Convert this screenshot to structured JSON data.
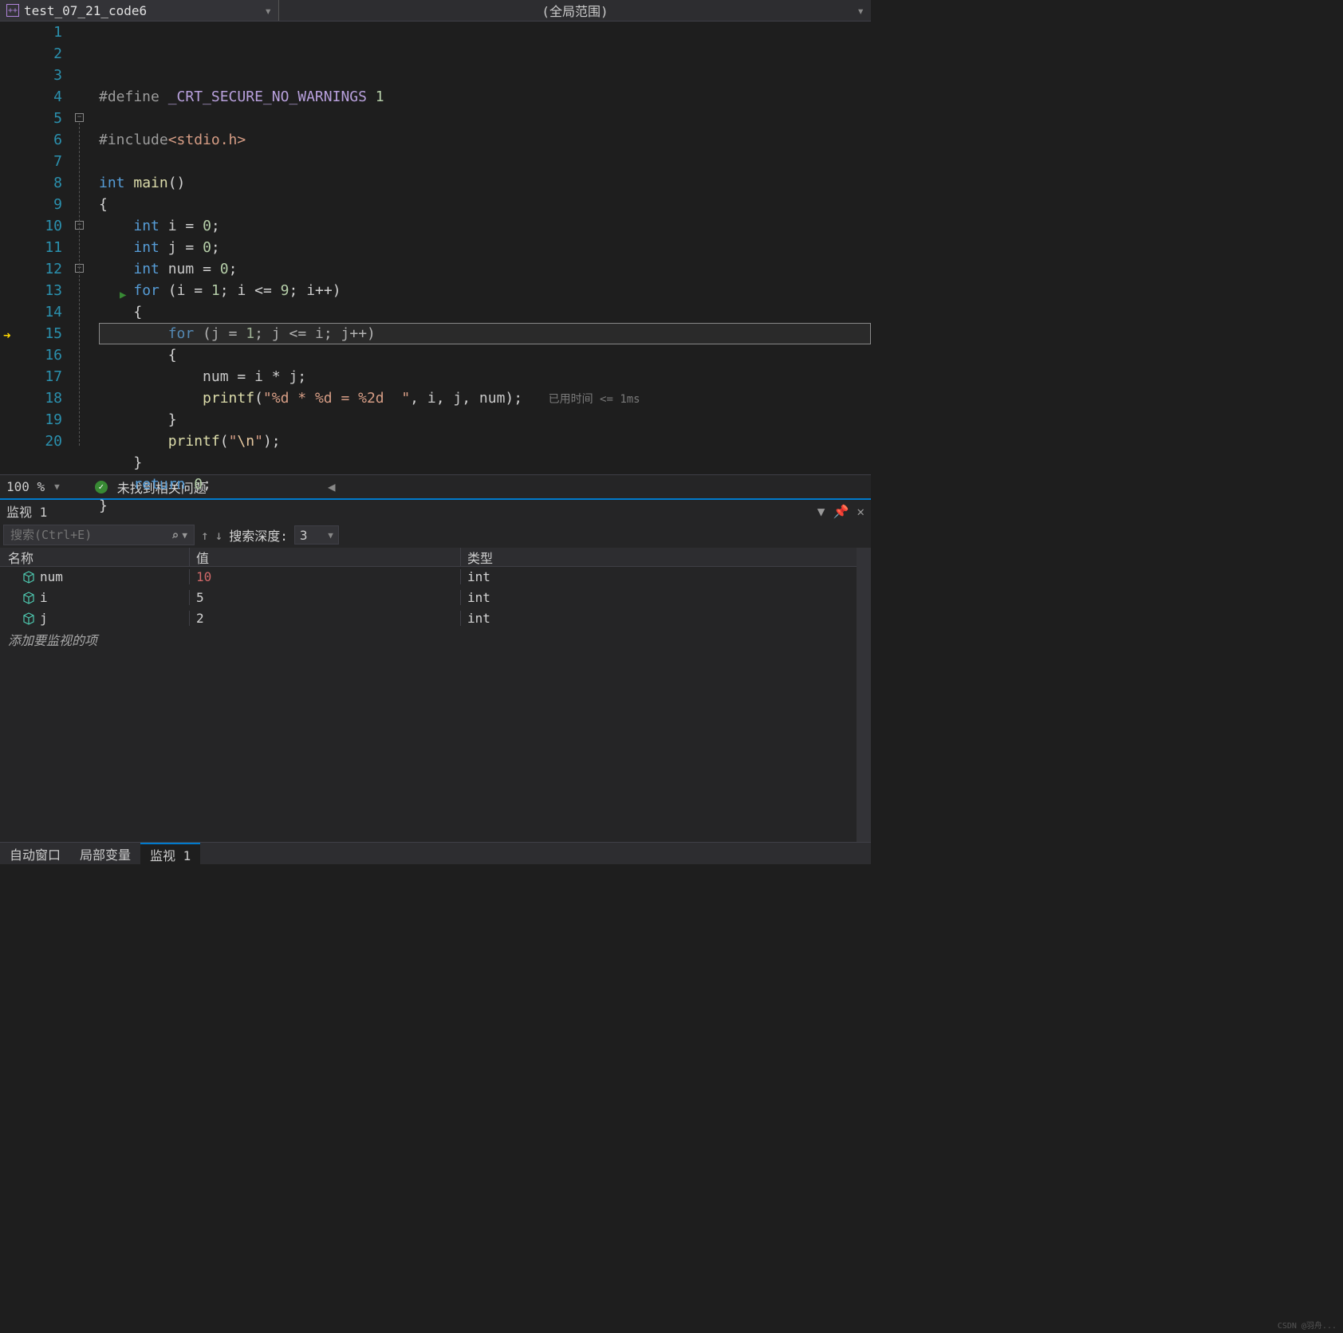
{
  "header": {
    "file_name": "test_07_21_code6",
    "scope": "(全局范围)"
  },
  "editor": {
    "current_line_index": 14,
    "lines": [
      {
        "n": 1,
        "html": "<span class='pp'>#define </span><span class='mac'>_CRT_SECURE_NO_WARNINGS</span> <span class='num'>1</span>"
      },
      {
        "n": 2,
        "html": ""
      },
      {
        "n": 3,
        "html": "<span class='pp'>#include</span><span class='angle'>&lt;stdio.h&gt;</span>"
      },
      {
        "n": 4,
        "html": ""
      },
      {
        "n": 5,
        "html": "<span class='kw'>int</span> <span class='fn'>main</span><span class='punc'>()</span>"
      },
      {
        "n": 6,
        "html": "<span class='punc'>{</span>"
      },
      {
        "n": 7,
        "html": "    <span class='kw'>int</span> <span class='id'>i</span> = <span class='num'>0</span>;"
      },
      {
        "n": 8,
        "html": "    <span class='kw'>int</span> <span class='id'>j</span> = <span class='num'>0</span>;"
      },
      {
        "n": 9,
        "html": "    <span class='kw'>int</span> <span class='id'>num</span> = <span class='num'>0</span>;"
      },
      {
        "n": 10,
        "html": "    <span class='kw'>for</span> (<span class='id'>i</span> = <span class='num'>1</span>; <span class='id'>i</span> &lt;= <span class='num'>9</span>; <span class='id'>i</span>++)"
      },
      {
        "n": 11,
        "html": "    <span class='punc'>{</span>"
      },
      {
        "n": 12,
        "html": "        <span class='kw'>for</span> (<span class='id'>j</span> = <span class='num'>1</span>; <span class='id'>j</span> &lt;= <span class='id'>i</span>; <span class='id'>j</span>++)"
      },
      {
        "n": 13,
        "html": "        <span class='punc'>{</span>"
      },
      {
        "n": 14,
        "html": "            <span class='id'>num</span> = <span class='id'>i</span> * <span class='id'>j</span>;"
      },
      {
        "n": 15,
        "html": "            <span class='fn'>printf</span>(<span class='str'>\"%d * %d = %2d  \"</span>, <span class='id'>i</span>, <span class='id'>j</span>, <span class='id'>num</span>);   <span class='perf-hint'>已用时间 &lt;= 1ms</span>"
      },
      {
        "n": 16,
        "html": "        <span class='punc'>}</span>"
      },
      {
        "n": 17,
        "html": "        <span class='fn'>printf</span>(<span class='str'>\"</span><span class='esc'>\\n</span><span class='str'>\"</span>);"
      },
      {
        "n": 18,
        "html": "    <span class='punc'>}</span>"
      },
      {
        "n": 19,
        "html": "    <span class='kw'>return</span> <span class='num'>0</span>;"
      },
      {
        "n": 20,
        "html": "<span class='punc'>}</span>"
      }
    ]
  },
  "status": {
    "zoom": "100 %",
    "issues": "未找到相关问题"
  },
  "watch": {
    "title": "监视 1",
    "search_placeholder": "搜索(Ctrl+E)",
    "depth_label": "搜索深度:",
    "depth_value": "3",
    "columns": {
      "name": "名称",
      "value": "值",
      "type": "类型"
    },
    "rows": [
      {
        "name": "num",
        "value": "10",
        "type": "int",
        "changed": true
      },
      {
        "name": "i",
        "value": "5",
        "type": "int",
        "changed": false
      },
      {
        "name": "j",
        "value": "2",
        "type": "int",
        "changed": false
      }
    ],
    "add_label": "添加要监视的项"
  },
  "bottom_tabs": {
    "auto": "自动窗口",
    "locals": "局部变量",
    "watch": "监视 1"
  },
  "watermark": "CSDN @羽舟..."
}
